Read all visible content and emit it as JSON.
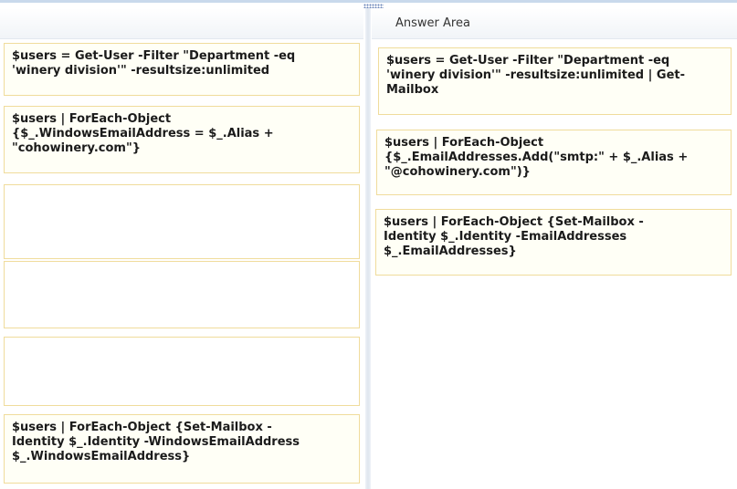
{
  "answer_area": {
    "title": "Answer Area"
  },
  "source_items": [
    {
      "text": "$users = Get-User -Filter \"Department -eq\n'winery division'\" -resultsize:unlimited"
    },
    {
      "text": "$users | ForEach-Object\n{$_.WindowsEmailAddress = $_.Alias +\n\"cohowinery.com\"}"
    },
    {
      "text": ""
    },
    {
      "text": ""
    },
    {
      "text": ""
    },
    {
      "text": "$users | ForEach-Object {Set-Mailbox -\nIdentity $_.Identity -WindowsEmailAddress\n$_.WindowsEmailAddress}"
    }
  ],
  "answer_items": [
    {
      "text": "$users = Get-User -Filter \"Department -eq\n'winery division'\" -resultsize:unlimited | Get-\nMailbox"
    },
    {
      "text": "$users | ForEach-Object\n{$_.EmailAddresses.Add(\"smtp:\" + $_.Alias +\n\"@cohowinery.com\")}"
    },
    {
      "text": "$users | ForEach-Object {Set-Mailbox -\nIdentity $_.Identity -EmailAddresses\n$_.EmailAddresses}"
    }
  ]
}
